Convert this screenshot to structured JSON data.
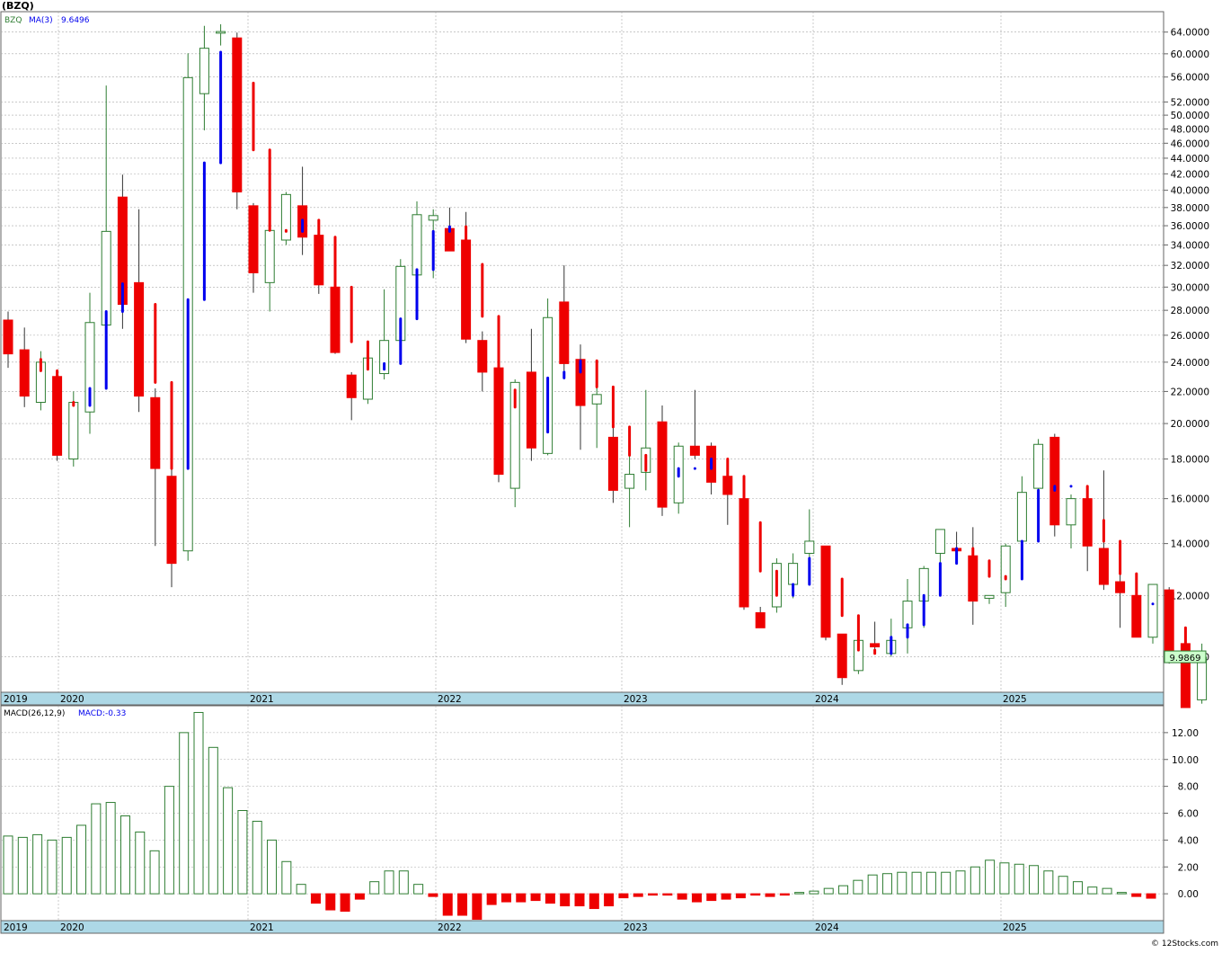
{
  "title": "(BZQ)",
  "legend": {
    "symbol": "BZQ",
    "ma_label": "MA(3)",
    "ma_value": "9.6496",
    "macd_label": "MACD(26,12,9)",
    "macd_value_label": "MACD:-0.33"
  },
  "last_price_label": "9.9869",
  "watermark": "© 12Stocks.com",
  "colors": {
    "up_candle": "#2e7d32",
    "down_candle": "#ee0000",
    "ma_up": "#0000ee",
    "ma_down": "#ee0000",
    "grid": "#a9a9a9",
    "axis_band": "#add8e6",
    "macd_pos": "#2e7d32",
    "macd_neg": "#ee0000"
  },
  "year_labels": [
    "2019",
    "2020",
    "2021",
    "2022",
    "2023",
    "2024",
    "2025"
  ],
  "chart_data": [
    {
      "type": "candlestick",
      "title": "(BZQ)",
      "period": "monthly",
      "y_scale": "log",
      "ylim": [
        9.0,
        68.0
      ],
      "y_ticks": [
        "64.0000",
        "60.0000",
        "56.0000",
        "52.0000",
        "50.0000",
        "48.0000",
        "46.0000",
        "44.0000",
        "42.0000",
        "40.0000",
        "38.0000",
        "36.0000",
        "34.0000",
        "32.0000",
        "30.0000",
        "28.0000",
        "26.0000",
        "24.0000",
        "22.0000",
        "20.0000",
        "18.0000",
        "16.0000",
        "14.0000",
        "12.0000",
        "10.0000"
      ],
      "x_years": [
        "2019",
        "2020",
        "2021",
        "2022",
        "2023",
        "2024",
        "2025"
      ],
      "grid": true,
      "ma3_value": 9.6496,
      "last_close": 9.9869,
      "candles": [
        {
          "o": 27.2,
          "h": 27.9,
          "l": 23.6,
          "c": 24.6
        },
        {
          "o": 24.9,
          "h": 26.6,
          "l": 21.0,
          "c": 21.7
        },
        {
          "o": 21.3,
          "h": 24.8,
          "l": 20.8,
          "c": 24.0
        },
        {
          "o": 23.0,
          "h": 23.3,
          "l": 17.9,
          "c": 18.2
        },
        {
          "o": 18.0,
          "h": 22.0,
          "l": 17.6,
          "c": 21.3
        },
        {
          "o": 20.7,
          "h": 29.5,
          "l": 19.4,
          "c": 27.0
        },
        {
          "o": 26.8,
          "h": 54.6,
          "l": 24.3,
          "c": 35.4
        },
        {
          "o": 39.2,
          "h": 41.9,
          "l": 26.5,
          "c": 28.5
        },
        {
          "o": 30.4,
          "h": 37.8,
          "l": 20.7,
          "c": 21.7
        },
        {
          "o": 21.6,
          "h": 22.2,
          "l": 13.9,
          "c": 17.5
        },
        {
          "o": 17.1,
          "h": 17.8,
          "l": 12.3,
          "c": 13.2
        },
        {
          "o": 13.7,
          "h": 60.1,
          "l": 13.3,
          "c": 55.9
        },
        {
          "o": 53.3,
          "h": 65.2,
          "l": 47.8,
          "c": 61.0
        },
        {
          "o": 63.8,
          "h": 65.5,
          "l": 61.5,
          "c": 64.1
        },
        {
          "o": 62.9,
          "h": 63.9,
          "l": 37.8,
          "c": 39.8
        },
        {
          "o": 38.2,
          "h": 38.5,
          "l": 29.5,
          "c": 31.3
        },
        {
          "o": 30.4,
          "h": 36.5,
          "l": 27.9,
          "c": 35.5
        },
        {
          "o": 34.5,
          "h": 39.8,
          "l": 34.0,
          "c": 39.5
        },
        {
          "o": 38.2,
          "h": 42.9,
          "l": 33.0,
          "c": 34.8
        },
        {
          "o": 35.0,
          "h": 36.6,
          "l": 29.4,
          "c": 30.2
        },
        {
          "o": 30.0,
          "h": 31.1,
          "l": 24.6,
          "c": 24.7
        },
        {
          "o": 23.1,
          "h": 23.3,
          "l": 20.2,
          "c": 21.6
        },
        {
          "o": 21.5,
          "h": 24.9,
          "l": 21.2,
          "c": 24.3
        },
        {
          "o": 23.2,
          "h": 29.8,
          "l": 22.8,
          "c": 25.6
        },
        {
          "o": 25.6,
          "h": 32.6,
          "l": 24.6,
          "c": 31.9
        },
        {
          "o": 31.1,
          "h": 38.7,
          "l": 29.4,
          "c": 37.2
        },
        {
          "o": 36.6,
          "h": 37.8,
          "l": 30.8,
          "c": 37.1
        },
        {
          "o": 35.7,
          "h": 38.0,
          "l": 33.4,
          "c": 33.4
        },
        {
          "o": 34.5,
          "h": 37.5,
          "l": 25.4,
          "c": 25.7
        },
        {
          "o": 25.6,
          "h": 26.3,
          "l": 22.0,
          "c": 23.3
        },
        {
          "o": 23.6,
          "h": 23.7,
          "l": 16.8,
          "c": 17.2
        },
        {
          "o": 16.5,
          "h": 22.8,
          "l": 15.6,
          "c": 22.6
        },
        {
          "o": 23.3,
          "h": 26.5,
          "l": 17.9,
          "c": 18.6
        },
        {
          "o": 18.3,
          "h": 29.0,
          "l": 18.2,
          "c": 27.4
        },
        {
          "o": 28.7,
          "h": 32.0,
          "l": 23.4,
          "c": 23.9
        },
        {
          "o": 24.2,
          "h": 25.3,
          "l": 18.5,
          "c": 21.1
        },
        {
          "o": 21.2,
          "h": 23.8,
          "l": 18.6,
          "c": 21.8
        },
        {
          "o": 19.2,
          "h": 20.0,
          "l": 15.8,
          "c": 16.4
        },
        {
          "o": 16.5,
          "h": 19.6,
          "l": 14.7,
          "c": 17.2
        },
        {
          "o": 17.3,
          "h": 22.1,
          "l": 16.4,
          "c": 18.6
        },
        {
          "o": 20.1,
          "h": 21.1,
          "l": 15.2,
          "c": 15.6
        },
        {
          "o": 15.8,
          "h": 18.9,
          "l": 15.3,
          "c": 18.7
        },
        {
          "o": 18.7,
          "h": 22.1,
          "l": 18.0,
          "c": 18.2
        },
        {
          "o": 18.7,
          "h": 18.9,
          "l": 16.2,
          "c": 16.8
        },
        {
          "o": 17.1,
          "h": 17.2,
          "l": 14.8,
          "c": 16.2
        },
        {
          "o": 16.0,
          "h": 16.1,
          "l": 11.5,
          "c": 11.6
        },
        {
          "o": 11.4,
          "h": 11.6,
          "l": 10.9,
          "c": 10.9
        },
        {
          "o": 11.6,
          "h": 13.4,
          "l": 11.4,
          "c": 13.2
        },
        {
          "o": 12.4,
          "h": 13.6,
          "l": 11.9,
          "c": 13.2
        },
        {
          "o": 13.6,
          "h": 15.5,
          "l": 13.3,
          "c": 14.1
        },
        {
          "o": 13.9,
          "h": 13.9,
          "l": 10.5,
          "c": 10.6
        },
        {
          "o": 10.7,
          "h": 10.7,
          "l": 9.2,
          "c": 9.4
        },
        {
          "o": 9.6,
          "h": 11.0,
          "l": 9.5,
          "c": 10.5
        },
        {
          "o": 10.4,
          "h": 11.1,
          "l": 10.1,
          "c": 10.3
        },
        {
          "o": 10.1,
          "h": 11.2,
          "l": 10.0,
          "c": 10.5
        },
        {
          "o": 10.9,
          "h": 12.6,
          "l": 10.1,
          "c": 11.8
        },
        {
          "o": 11.8,
          "h": 13.1,
          "l": 10.9,
          "c": 13.0
        },
        {
          "o": 13.6,
          "h": 14.6,
          "l": 12.7,
          "c": 14.6
        },
        {
          "o": 13.8,
          "h": 14.5,
          "l": 13.6,
          "c": 13.7
        },
        {
          "o": 13.5,
          "h": 14.7,
          "l": 11.0,
          "c": 11.8
        },
        {
          "o": 11.9,
          "h": 12.0,
          "l": 11.7,
          "c": 12.0
        },
        {
          "o": 12.1,
          "h": 14.0,
          "l": 11.6,
          "c": 13.9
        },
        {
          "o": 14.1,
          "h": 17.1,
          "l": 13.9,
          "c": 16.3
        },
        {
          "o": 16.5,
          "h": 19.1,
          "l": 16.3,
          "c": 18.8
        },
        {
          "o": 19.2,
          "h": 19.4,
          "l": 14.3,
          "c": 14.8
        },
        {
          "o": 14.8,
          "h": 16.2,
          "l": 13.8,
          "c": 16.0
        },
        {
          "o": 16.0,
          "h": 16.5,
          "l": 12.9,
          "c": 13.9
        },
        {
          "o": 13.8,
          "h": 17.4,
          "l": 12.2,
          "c": 12.4
        },
        {
          "o": 12.5,
          "h": 12.8,
          "l": 10.9,
          "c": 12.1
        },
        {
          "o": 12.0,
          "h": 12.3,
          "l": 10.6,
          "c": 10.6
        },
        {
          "o": 10.6,
          "h": 12.4,
          "l": 10.4,
          "c": 12.4
        },
        {
          "o": 12.2,
          "h": 12.3,
          "l": 9.8,
          "c": 9.9
        },
        {
          "o": 10.4,
          "h": 10.5,
          "l": 8.6,
          "c": 8.6
        },
        {
          "o": 8.8,
          "h": 10.4,
          "l": 8.7,
          "c": 9.9869
        }
      ],
      "ma3": [
        24.6,
        24.2,
        23.4,
        21.3,
        21.1,
        22.2,
        27.9,
        30.3,
        28.5,
        22.6,
        17.5,
        28.9,
        43.4,
        60.3,
        55.0,
        45.1,
        35.5,
        35.4,
        36.6,
        34.8,
        30.0,
        25.5,
        23.5,
        23.9,
        27.3,
        31.6,
        35.4,
        35.9,
        32.1,
        27.5,
        22.1,
        21.0,
        19.5,
        22.9,
        23.3,
        24.1,
        22.3,
        19.8,
        18.2,
        17.4,
        17.1,
        17.5,
        17.5,
        18.0,
        17.1,
        14.9,
        12.9,
        12.0,
        12.4,
        13.4,
        12.6,
        11.3,
        10.2,
        10.1,
        10.6,
        11.0,
        12.0,
        13.2,
        13.8,
        13.3,
        12.7,
        12.6,
        14.1,
        16.4,
        16.6,
        16.6,
        15.0,
        14.1,
        12.8,
        11.7,
        11.7,
        10.9,
        9.6496
      ]
    },
    {
      "type": "bar",
      "title": "MACD(26,12,9)",
      "ylim": [
        -2.0,
        14.0
      ],
      "y_ticks": [
        "12.00",
        "10.00",
        "8.00",
        "6.00",
        "4.00",
        "2.00",
        "0.00"
      ],
      "x_years": [
        "2019",
        "2020",
        "2021",
        "2022",
        "2023",
        "2024",
        "2025"
      ],
      "grid": true,
      "current": -0.33,
      "values": [
        4.3,
        4.2,
        4.4,
        4.0,
        4.2,
        5.1,
        6.7,
        6.8,
        5.8,
        4.6,
        3.2,
        8.0,
        12.0,
        13.5,
        10.9,
        7.9,
        6.2,
        5.4,
        4.0,
        2.4,
        0.7,
        -0.7,
        -1.2,
        -1.3,
        -0.4,
        0.9,
        1.7,
        1.7,
        0.7,
        -0.2,
        -1.6,
        -1.6,
        -1.9,
        -0.8,
        -0.6,
        -0.6,
        -0.5,
        -0.7,
        -0.9,
        -0.9,
        -1.1,
        -0.9,
        -0.3,
        -0.2,
        -0.1,
        -0.1,
        -0.4,
        -0.6,
        -0.5,
        -0.4,
        -0.3,
        -0.1,
        -0.2,
        -0.1,
        0.1,
        0.2,
        0.4,
        0.6,
        1.0,
        1.4,
        1.5,
        1.6,
        1.6,
        1.6,
        1.6,
        1.7,
        2.0,
        2.5,
        2.3,
        2.2,
        2.1,
        1.7,
        1.3,
        0.9,
        0.5,
        0.4,
        0.1,
        -0.2,
        -0.33
      ]
    }
  ]
}
